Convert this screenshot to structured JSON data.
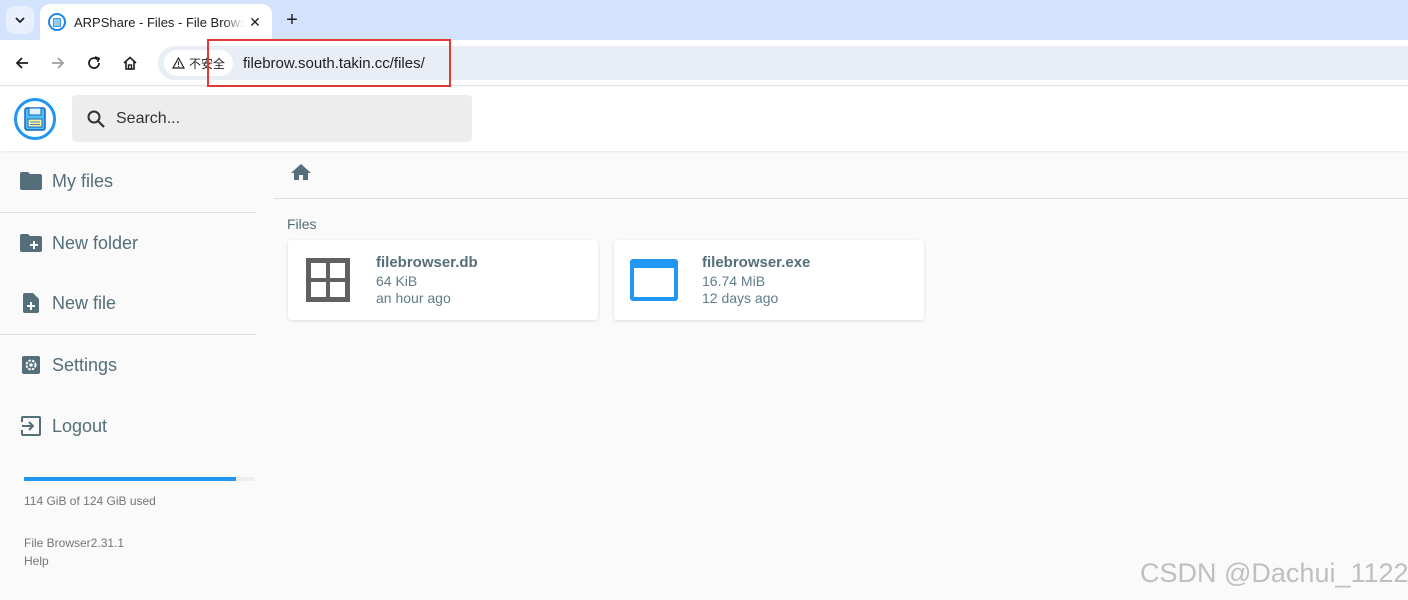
{
  "browser": {
    "tab_title": "ARPShare - Files - File Browser",
    "tab_close": "✕",
    "new_tab": "+",
    "security_label": "不安全",
    "url": "filebrow.south.takin.cc/files/"
  },
  "header": {
    "search_placeholder": "Search..."
  },
  "sidebar": {
    "items": [
      {
        "label": "My files",
        "icon": "folder-icon"
      },
      {
        "label": "New folder",
        "icon": "create-new-folder-icon"
      },
      {
        "label": "New file",
        "icon": "note-add-icon"
      },
      {
        "label": "Settings",
        "icon": "settings-icon"
      },
      {
        "label": "Logout",
        "icon": "exit-icon"
      }
    ],
    "usage_fraction": 0.92,
    "usage_text": "114 GiB of 124 GiB used",
    "version": "File Browser2.31.1",
    "help": "Help"
  },
  "main": {
    "section_title": "Files",
    "files": [
      {
        "name": "filebrowser.db",
        "size": "64 KiB",
        "modified": "an hour ago",
        "icon": "grid-icon"
      },
      {
        "name": "filebrowser.exe",
        "size": "16.74 MiB",
        "modified": "12 days ago",
        "icon": "application-window-icon"
      }
    ]
  },
  "colors": {
    "accent": "#2196f3",
    "sidebar_text": "#546e7a",
    "highlight_box": "#e53935"
  },
  "watermark": "CSDN @Dachui_1122"
}
